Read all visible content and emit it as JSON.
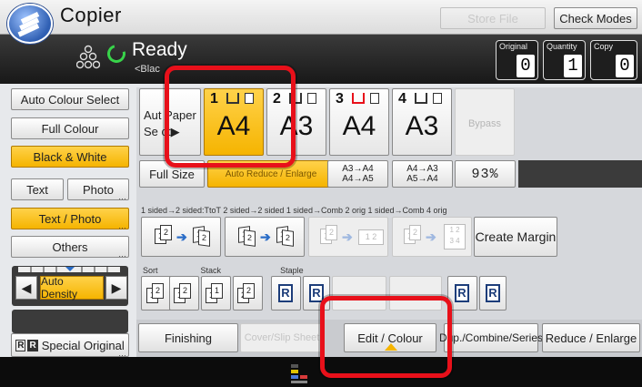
{
  "window": {
    "title": "Copier",
    "store_file": "Store File",
    "check_modes": "Check Modes"
  },
  "status": {
    "state": "Ready",
    "sub": "<Blac",
    "counters": [
      {
        "label": "Original",
        "value": "0"
      },
      {
        "label": "Quantity",
        "value": "1"
      },
      {
        "label": "Copy",
        "value": "0"
      }
    ]
  },
  "left_panel": {
    "auto_colour_select": "Auto Colour Select",
    "full_colour": "Full Colour",
    "black_white": "Black & White",
    "text": "Text",
    "photo": "Photo",
    "text_photo": "Text / Photo",
    "others": "Others",
    "auto_density": "Auto Density",
    "special_original": "Special Original"
  },
  "paper": {
    "auto_select_1": "Aut",
    "auto_select_2": "Paper",
    "auto_select_3": "Se",
    "auto_select_4": "ct",
    "trays": [
      {
        "num": "1",
        "size": "A4"
      },
      {
        "num": "2",
        "size": "A3"
      },
      {
        "num": "3",
        "size": "A4"
      },
      {
        "num": "4",
        "size": "A3"
      }
    ],
    "bypass": "Bypass"
  },
  "reduce": {
    "full_size": "Full Size",
    "auto_reduce": "Auto Reduce / Enlarge",
    "a3a4_1": "A3→A4",
    "a3a4_2": "A4→A5",
    "a4a3_1": "A4→A3",
    "a4a3_2": "A5→A4",
    "zoom": "93%"
  },
  "duplex": {
    "labels": "1 sided→2 sided:TtoT   2 sided→2 sided   1 sided→Comb 2 orig 1 sided→Comb 4 orig",
    "create_margin": "Create Margin"
  },
  "finishing_labels": {
    "sort": "Sort",
    "stack": "Stack",
    "staple": "Staple"
  },
  "tabs": {
    "finishing": "Finishing",
    "cover": "Cover/Slip Sheet",
    "edit": "Edit / Colour",
    "dup": "Dup./Combine/Series",
    "reduce": "Reduce / Enlarge"
  },
  "colors": {
    "selected": "#f5b400",
    "highlight": "#e8101a",
    "ready_green": "#38d44a"
  },
  "icons": {
    "app_logo": "copier-logo-icon",
    "copies": "copies-icon",
    "ready": "ready-circle-icon",
    "bottom_logo": "kyocera-stack-icon"
  }
}
